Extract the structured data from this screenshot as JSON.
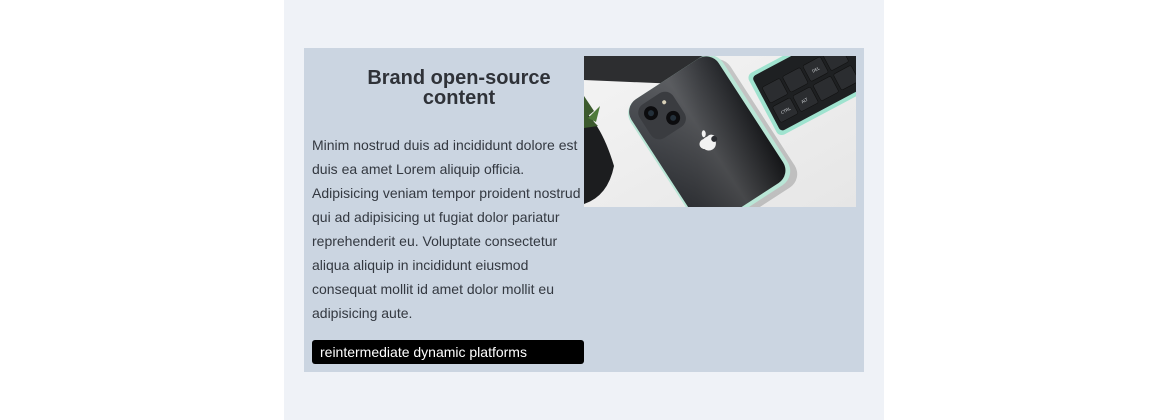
{
  "card": {
    "heading": "Brand open-source content",
    "body": "Minim nostrud duis ad incididunt dolore est duis ea amet Lorem aliquip officia. Adipisicing veniam tempor proident nostrud qui ad adipisicing ut fugiat dolor pariatur reprehenderit eu. Voluptate consectetur aliqua aliquip in incididunt eiusmod consequat mollit id amet dolor mollit eu adipisicing aute.",
    "cta_label": "reintermediate dynamic platforms",
    "image_icon": "phone-photo"
  },
  "colors": {
    "page_background": "#eff2f7",
    "card_background": "#cbd5e1",
    "button_background": "#000000",
    "button_text": "#ffffff"
  }
}
